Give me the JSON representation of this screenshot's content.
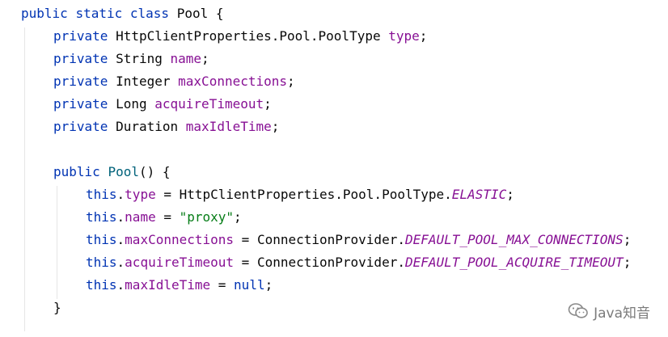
{
  "code": {
    "class_decl": {
      "kw_public": "public",
      "kw_static": "static",
      "kw_class": "class",
      "name": "Pool",
      "brace": "{"
    },
    "fields": [
      {
        "modifier": "private",
        "type": "HttpClientProperties.Pool.PoolType",
        "name": "type",
        "end": ";"
      },
      {
        "modifier": "private",
        "type": "String",
        "name": "name",
        "end": ";"
      },
      {
        "modifier": "private",
        "type": "Integer",
        "name": "maxConnections",
        "end": ";"
      },
      {
        "modifier": "private",
        "type": "Long",
        "name": "acquireTimeout",
        "end": ";"
      },
      {
        "modifier": "private",
        "type": "Duration",
        "name": "maxIdleTime",
        "end": ";"
      }
    ],
    "constructor": {
      "kw_public": "public",
      "name": "Pool",
      "signature_rest": "() {"
    },
    "assignments": [
      {
        "this": "this",
        "dot": ".",
        "field": "type",
        "op": " = ",
        "value_prefix": "HttpClientProperties.Pool.PoolType.",
        "value_static": "ELASTIC",
        "value_str": "",
        "value_kw": "",
        "end": ";"
      },
      {
        "this": "this",
        "dot": ".",
        "field": "name",
        "op": " = ",
        "value_prefix": "",
        "value_static": "",
        "value_str": "\"proxy\"",
        "value_kw": "",
        "end": ";"
      },
      {
        "this": "this",
        "dot": ".",
        "field": "maxConnections",
        "op": " = ",
        "value_prefix": "ConnectionProvider.",
        "value_static": "DEFAULT_POOL_MAX_CONNECTIONS",
        "value_str": "",
        "value_kw": "",
        "end": ";"
      },
      {
        "this": "this",
        "dot": ".",
        "field": "acquireTimeout",
        "op": " = ",
        "value_prefix": "ConnectionProvider.",
        "value_static": "DEFAULT_POOL_ACQUIRE_TIMEOUT",
        "value_str": "",
        "value_kw": "",
        "end": ";"
      },
      {
        "this": "this",
        "dot": ".",
        "field": "maxIdleTime",
        "op": " = ",
        "value_prefix": "",
        "value_static": "",
        "value_str": "",
        "value_kw": "null",
        "end": ";"
      }
    ],
    "constructor_close": "}"
  },
  "watermark": {
    "text": "Java知音",
    "icon": "wechat-icon"
  },
  "colors": {
    "keyword": "#0033b3",
    "field": "#871094",
    "string": "#067d17",
    "method": "#00627a",
    "text": "#080808"
  }
}
